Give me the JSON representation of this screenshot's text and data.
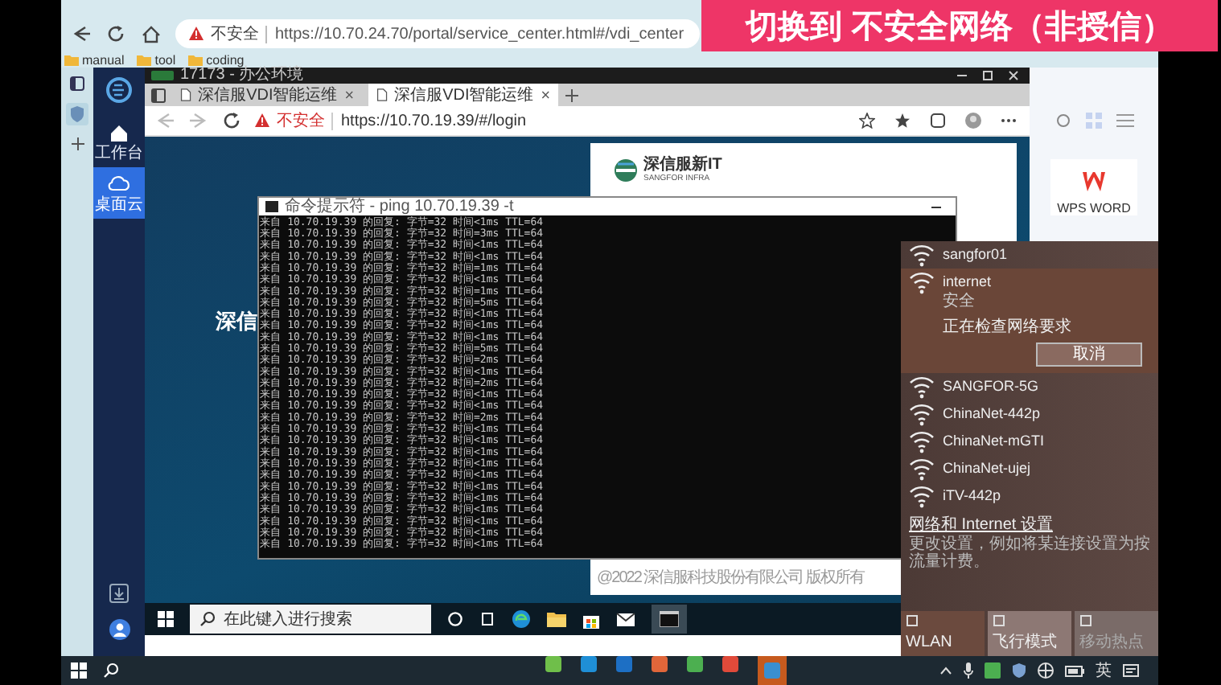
{
  "banner": {
    "text": "切换到 不安全网络（非授信）"
  },
  "browser": {
    "security_label": "不安全",
    "url": "https://10.70.24.70/portal/service_center.html#/vdi_center",
    "bookmarks": [
      "manual",
      "tool",
      "coding"
    ]
  },
  "app_sidebar": {
    "items": [
      {
        "label": "工作台",
        "selected": false
      },
      {
        "label": "桌面云",
        "selected": true
      }
    ]
  },
  "vdi_window": {
    "title": "17173 - 办公环境",
    "tabs": [
      {
        "label": "深信服VDI智能运维",
        "selected": false
      },
      {
        "label": "深信服VDI智能运维",
        "selected": true
      }
    ],
    "security_label": "不安全",
    "url": "https://10.70.19.39/#/login",
    "page": {
      "heading": "深信",
      "brand": "深信服新IT",
      "brand_sub": "SANGFOR INFRA",
      "footer": "@2022 深信服科技股份有限公司 版权所有"
    },
    "taskbar": {
      "search_placeholder": "在此键入进行搜索"
    }
  },
  "console": {
    "title": "命令提示符 - ping 10.70.19.39 -t",
    "lines": [
      "来自 10.70.19.39 的回复: 字节=32 时间<1ms TTL=64",
      "来自 10.70.19.39 的回复: 字节=32 时间=3ms TTL=64",
      "来自 10.70.19.39 的回复: 字节=32 时间<1ms TTL=64",
      "来自 10.70.19.39 的回复: 字节=32 时间<1ms TTL=64",
      "来自 10.70.19.39 的回复: 字节=32 时间=1ms TTL=64",
      "来自 10.70.19.39 的回复: 字节=32 时间<1ms TTL=64",
      "来自 10.70.19.39 的回复: 字节=32 时间=1ms TTL=64",
      "来自 10.70.19.39 的回复: 字节=32 时间=5ms TTL=64",
      "来自 10.70.19.39 的回复: 字节=32 时间<1ms TTL=64",
      "来自 10.70.19.39 的回复: 字节=32 时间<1ms TTL=64",
      "来自 10.70.19.39 的回复: 字节=32 时间<1ms TTL=64",
      "来自 10.70.19.39 的回复: 字节=32 时间=5ms TTL=64",
      "来自 10.70.19.39 的回复: 字节=32 时间=2ms TTL=64",
      "来自 10.70.19.39 的回复: 字节=32 时间<1ms TTL=64",
      "来自 10.70.19.39 的回复: 字节=32 时间=2ms TTL=64",
      "来自 10.70.19.39 的回复: 字节=32 时间<1ms TTL=64",
      "来自 10.70.19.39 的回复: 字节=32 时间<1ms TTL=64",
      "来自 10.70.19.39 的回复: 字节=32 时间=2ms TTL=64",
      "来自 10.70.19.39 的回复: 字节=32 时间<1ms TTL=64",
      "来自 10.70.19.39 的回复: 字节=32 时间<1ms TTL=64",
      "来自 10.70.19.39 的回复: 字节=32 时间<1ms TTL=64",
      "来自 10.70.19.39 的回复: 字节=32 时间<1ms TTL=64",
      "来自 10.70.19.39 的回复: 字节=32 时间<1ms TTL=64",
      "来自 10.70.19.39 的回复: 字节=32 时间<1ms TTL=64",
      "来自 10.70.19.39 的回复: 字节=32 时间<1ms TTL=64",
      "来自 10.70.19.39 的回复: 字节=32 时间<1ms TTL=64",
      "来自 10.70.19.39 的回复: 字节=32 时间<1ms TTL=64",
      "来自 10.70.19.39 的回复: 字节=32 时间<1ms TTL=64",
      "来自 10.70.19.39 的回复: 字节=32 时间<1ms TTL=64"
    ]
  },
  "right_pane": {
    "app_label": "WPS WORD"
  },
  "wifi": {
    "networks": [
      {
        "name": "sangfor01",
        "expanded": false
      },
      {
        "name": "internet",
        "expanded": true,
        "status": "安全",
        "message": "正在检查网络要求",
        "button": "取消"
      },
      {
        "name": "SANGFOR-5G",
        "expanded": false
      },
      {
        "name": "ChinaNet-442p",
        "expanded": false
      },
      {
        "name": "ChinaNet-mGTI",
        "expanded": false
      },
      {
        "name": "ChinaNet-ujej",
        "expanded": false
      },
      {
        "name": "iTV-442p",
        "expanded": false
      }
    ],
    "settings_link": "网络和 Internet 设置",
    "settings_hint": "更改设置，例如将某连接设置为按流量计费。",
    "tiles": [
      {
        "label": "WLAN",
        "disabled": false
      },
      {
        "label": "飞行模式",
        "disabled": false
      },
      {
        "label": "移动热点",
        "disabled": true
      }
    ]
  },
  "taskbar": {
    "ime": "英"
  }
}
